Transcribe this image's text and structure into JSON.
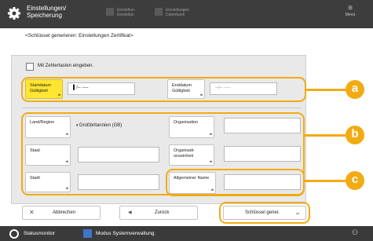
{
  "topbar": {
    "title": "Einstellungen/ Speicherung",
    "btn1": "Einstellun- Einstellgn",
    "btn2": "Einstellungen Datenbank",
    "menu": "Menü"
  },
  "breadcrumb": "<Schlüssel generieren: Einstellungen Zertifikat>",
  "checkbox_label": "Mit Zehlertasten eingeben.",
  "fields": {
    "start_key": "Startdatum Gültigkeit",
    "start_value": "▌/-- ----",
    "end_key": "Enddatum Gültigkeit",
    "end_value": "--/-- ----",
    "country_key": "Land/Region",
    "country_value": "Großbritannien (GB)",
    "org_key": "Organisation",
    "state_key": "Staat",
    "orgunit_key": "Organisati- onseinheit",
    "city_key": "Stadt",
    "cn_key": "Allgemeiner Name"
  },
  "callouts": [
    "a",
    "b",
    "c"
  ],
  "buttons": {
    "cancel": "Abbrechen",
    "back": "Zurück",
    "generate": "Schlüssel gener."
  },
  "statusbar": {
    "monitor": "Statusmonitor",
    "mode": "Modus Systemverwaltung."
  },
  "colors": {
    "accent": "#f2ab12",
    "highlight": "#ffe630",
    "bar": "#3d3d3d"
  }
}
